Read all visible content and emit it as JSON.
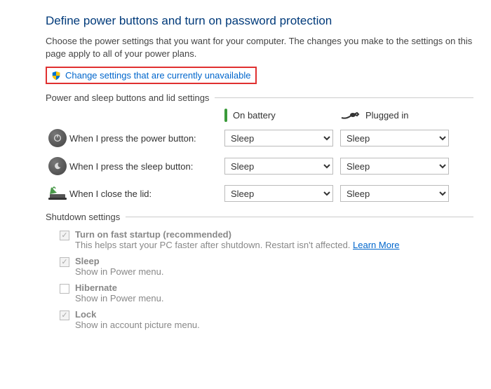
{
  "title": "Define power buttons and turn on password protection",
  "description": "Choose the power settings that you want for your computer. The changes you make to the settings on this page apply to all of your power plans.",
  "change_link": "Change settings that are currently unavailable",
  "section_buttons": {
    "header": "Power and sleep buttons and lid settings",
    "col_battery": "On battery",
    "col_plugged": "Plugged in",
    "rows": [
      {
        "label": "When I press the power button:",
        "battery": "Sleep",
        "plugged": "Sleep"
      },
      {
        "label": "When I press the sleep button:",
        "battery": "Sleep",
        "plugged": "Sleep"
      },
      {
        "label": "When I close the lid:",
        "battery": "Sleep",
        "plugged": "Sleep"
      }
    ]
  },
  "section_shutdown": {
    "header": "Shutdown settings",
    "items": [
      {
        "title": "Turn on fast startup (recommended)",
        "sub": "This helps start your PC faster after shutdown. Restart isn't affected. ",
        "learn": "Learn More",
        "checked": true
      },
      {
        "title": "Sleep",
        "sub": "Show in Power menu.",
        "checked": true
      },
      {
        "title": "Hibernate",
        "sub": "Show in Power menu.",
        "checked": false
      },
      {
        "title": "Lock",
        "sub": "Show in account picture menu.",
        "checked": true
      }
    ]
  }
}
